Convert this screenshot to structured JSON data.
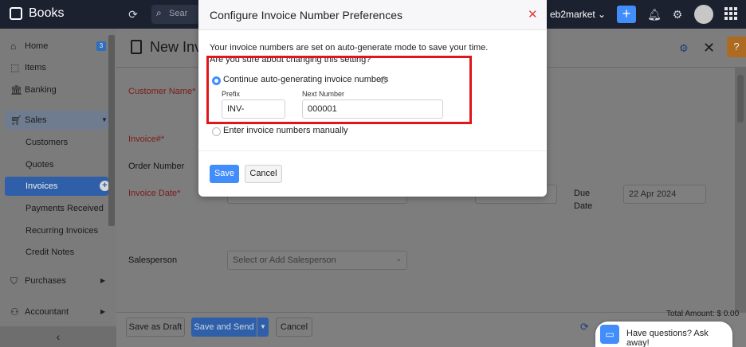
{
  "app": {
    "name": "Books",
    "org_name": "eb2market"
  },
  "topbar": {
    "search_placeholder": "Sear"
  },
  "sidebar": {
    "items": [
      {
        "label": "Home",
        "icon": "home-icon",
        "badge": "3"
      },
      {
        "label": "Items",
        "icon": "box-icon"
      },
      {
        "label": "Banking",
        "icon": "bank-icon"
      },
      {
        "label": "Sales",
        "icon": "cart-icon"
      },
      {
        "label": "Customers"
      },
      {
        "label": "Quotes"
      },
      {
        "label": "Invoices"
      },
      {
        "label": "Payments Received"
      },
      {
        "label": "Recurring Invoices"
      },
      {
        "label": "Credit Notes"
      },
      {
        "label": "Purchases",
        "icon": "bag-icon"
      },
      {
        "label": "Accountant",
        "icon": "person-icon"
      }
    ],
    "collapse_glyph": "‹"
  },
  "page": {
    "title": "New Invo",
    "labels": {
      "customer_name": "Customer Name*",
      "invoice_no": "Invoice#*",
      "order_number": "Order Number",
      "invoice_date": "Invoice Date*",
      "due_date_line1": "Due",
      "due_date_line2": "Date",
      "salesperson": "Salesperson"
    },
    "due_date_value": "22 Apr 2024",
    "salesperson_placeholder": "Select or Add Salesperson",
    "help_glyph": "?"
  },
  "footer": {
    "save_draft": "Save as Draft",
    "save_send": "Save and Send",
    "cancel": "Cancel",
    "total_amount": "Total Amount: $ 0.00"
  },
  "chat": {
    "label": "Have questions? Ask away!"
  },
  "modal": {
    "title": "Configure Invoice Number Preferences",
    "message_line1": "Your invoice numbers are set on auto-generate mode to save your time.",
    "message_line2": "Are you sure about changing this setting?",
    "option_auto": "Continue auto-generating invoice numbers",
    "prefix_label": "Prefix",
    "prefix_value": "INV-",
    "next_number_label": "Next Number",
    "next_number_value": "000001",
    "option_manual": "Enter invoice numbers manually",
    "save": "Save",
    "cancel": "Cancel",
    "selected_option": "auto"
  },
  "colors": {
    "accent": "#408dfb",
    "highlight_border": "#e0161b",
    "topbar": "#1c2130"
  }
}
